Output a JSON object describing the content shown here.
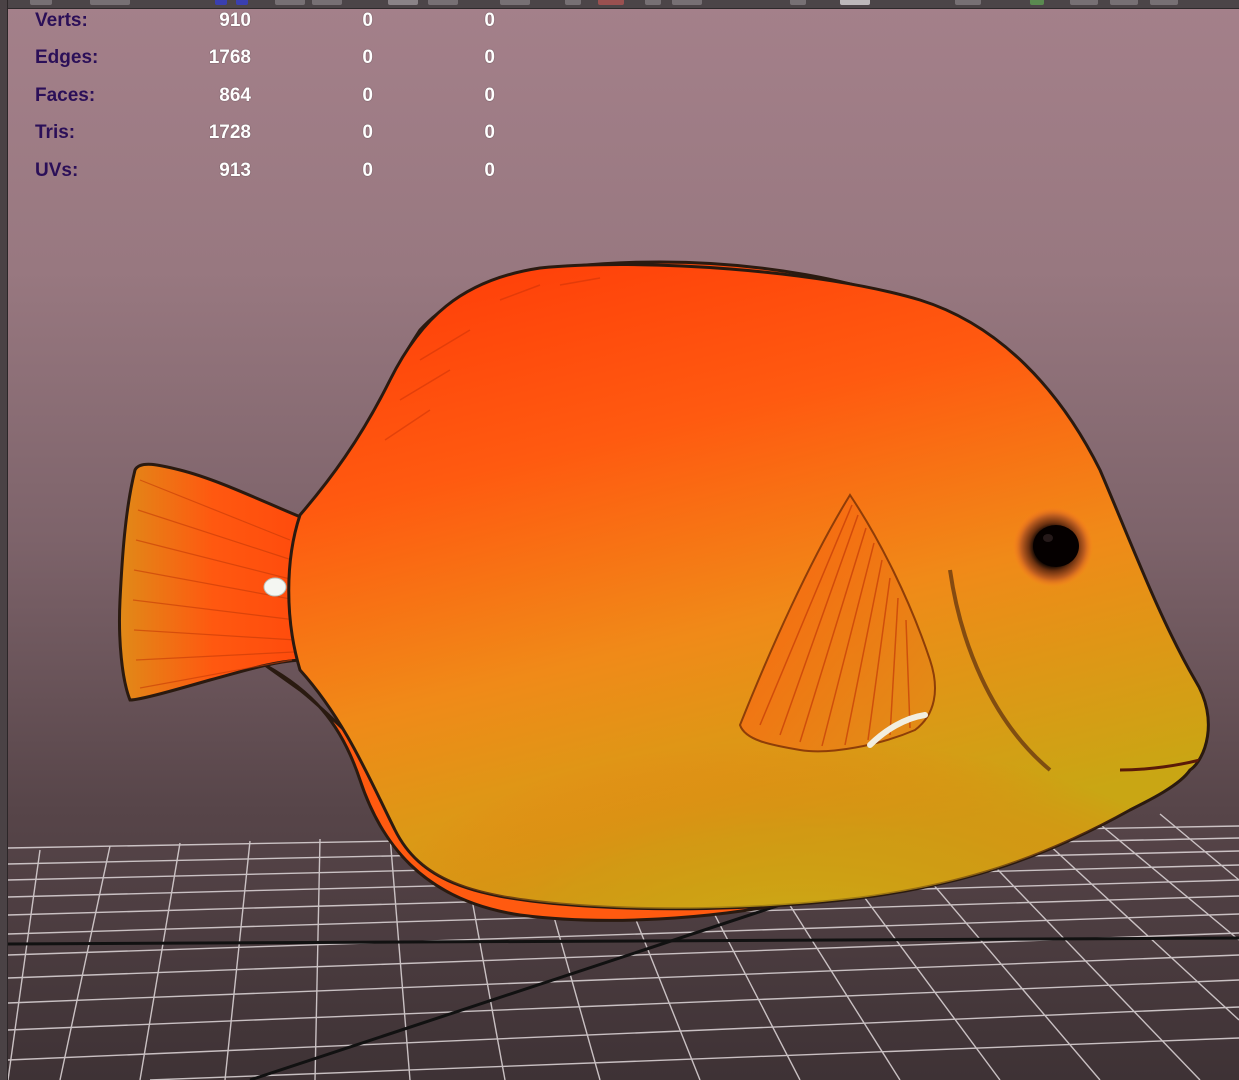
{
  "hud": {
    "rows": [
      {
        "label": "Verts:",
        "values": [
          "910",
          "0",
          "0"
        ]
      },
      {
        "label": "Edges:",
        "values": [
          "1768",
          "0",
          "0"
        ]
      },
      {
        "label": "Faces:",
        "values": [
          "864",
          "0",
          "0"
        ]
      },
      {
        "label": "Tris:",
        "values": [
          "1728",
          "0",
          "0"
        ]
      },
      {
        "label": "UVs:",
        "values": [
          "913",
          "0",
          "0"
        ]
      }
    ]
  },
  "colors": {
    "hud_label": "#2b0f58",
    "hud_value": "#ffffff",
    "background_top": "#a4808a",
    "background_bottom": "#3e3235",
    "fish_orange": "#ff5a10",
    "fish_yellow": "#d9b010",
    "grid_line": "#d8d0d2"
  },
  "icons": [
    "toolbar-button-icon",
    "grid-floor",
    "fish-model"
  ]
}
